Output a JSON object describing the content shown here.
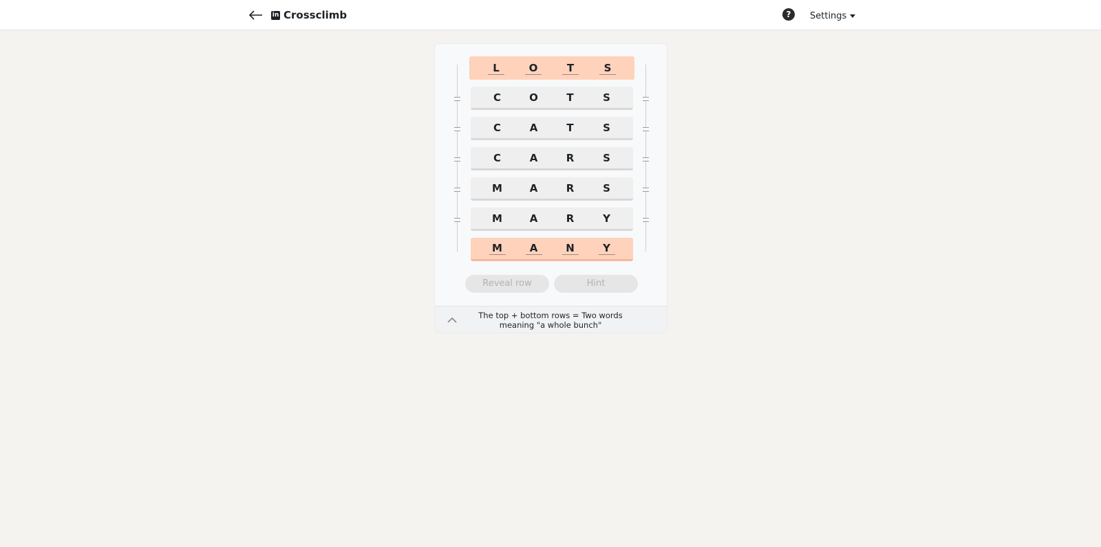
{
  "header": {
    "back_icon": "arrow-left-icon",
    "brand_icon": "linkedin-icon",
    "brand_icon_glyph": "in",
    "title": "Crossclimb",
    "help_icon": "question-circle-icon",
    "help_glyph": "?",
    "settings_label": "Settings"
  },
  "puzzle": {
    "rows": [
      {
        "letters": [
          "L",
          "O",
          "T",
          "S"
        ],
        "fixed": true
      },
      {
        "letters": [
          "C",
          "O",
          "T",
          "S"
        ],
        "fixed": false
      },
      {
        "letters": [
          "C",
          "A",
          "T",
          "S"
        ],
        "fixed": false
      },
      {
        "letters": [
          "C",
          "A",
          "R",
          "S"
        ],
        "fixed": false
      },
      {
        "letters": [
          "M",
          "A",
          "R",
          "S"
        ],
        "fixed": false
      },
      {
        "letters": [
          "M",
          "A",
          "R",
          "Y"
        ],
        "fixed": false
      },
      {
        "letters": [
          "M",
          "A",
          "N",
          "Y"
        ],
        "fixed": true
      }
    ],
    "reveal_row_label": "Reveal row",
    "hint_label": "Hint",
    "clue_line1": "The top + bottom rows = Two words",
    "clue_line2": "meaning \"a whole bunch\""
  },
  "colors": {
    "fixed_row": "#ffd2bb",
    "movable_row": "#efefef",
    "page_bg": "#f4f3f0"
  }
}
